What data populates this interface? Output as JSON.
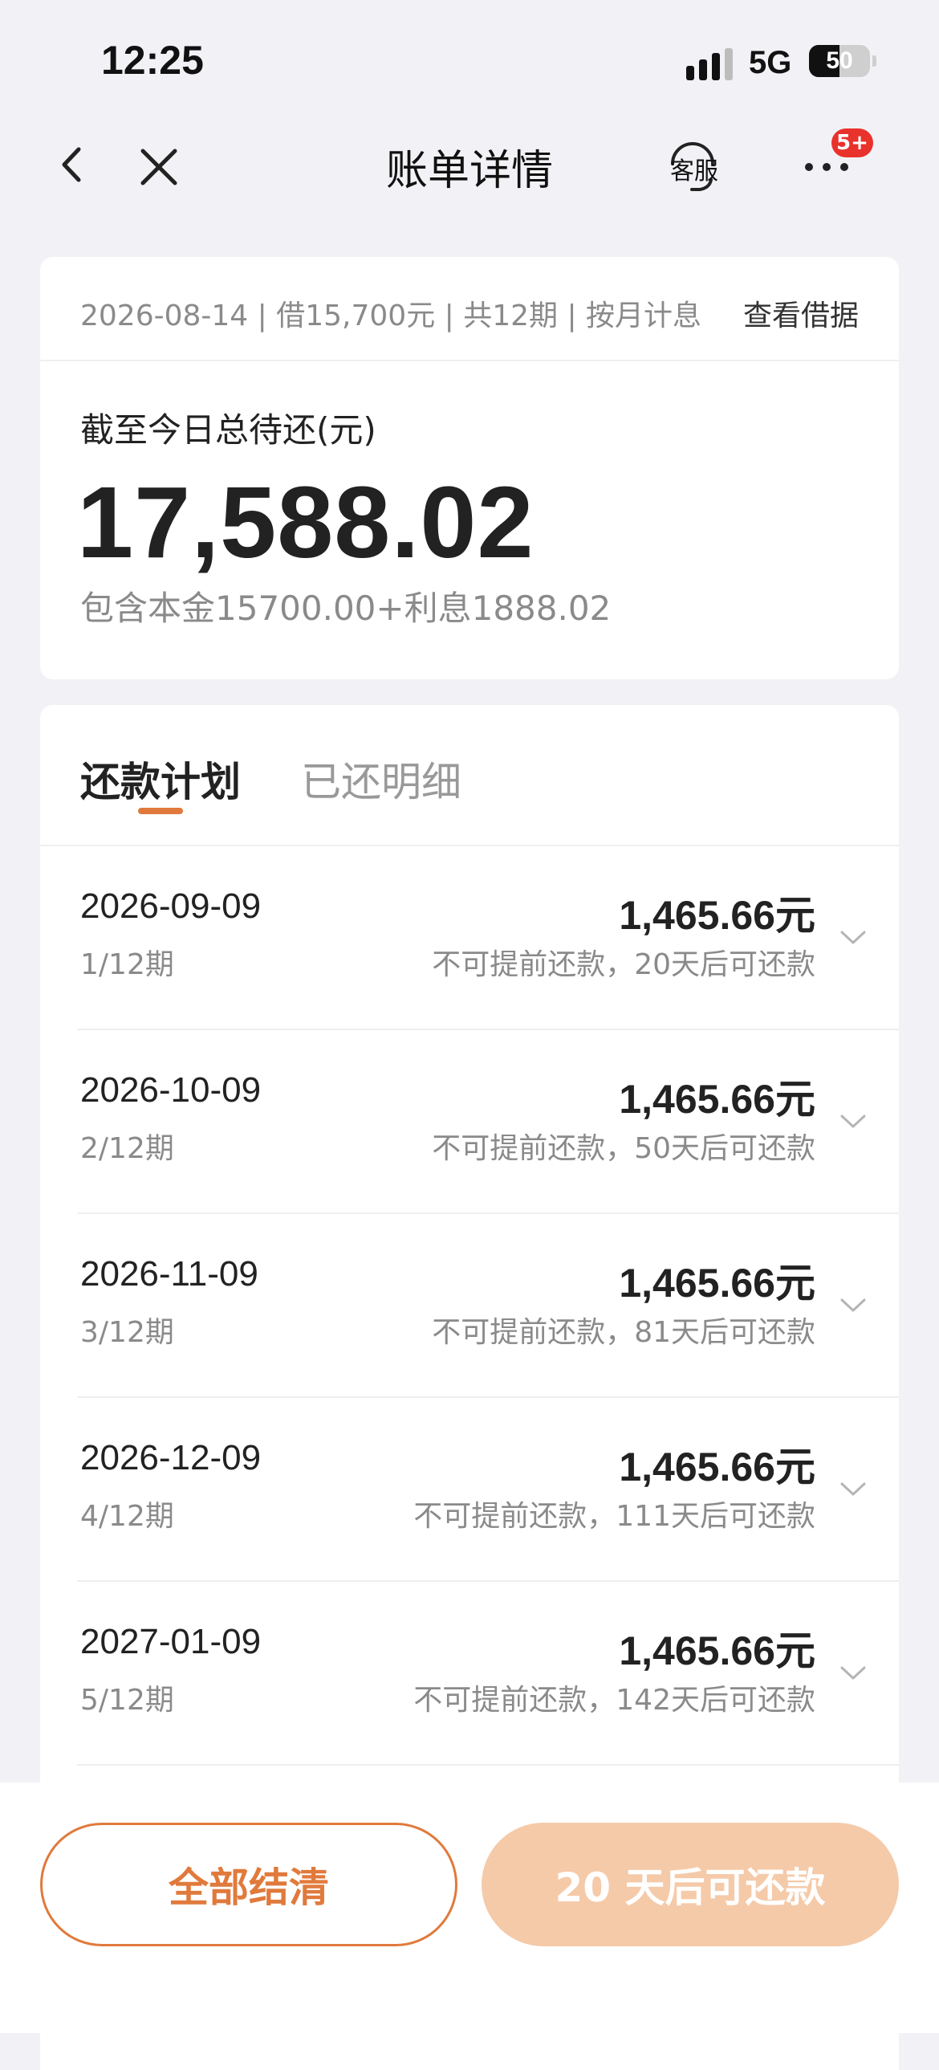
{
  "status_bar": {
    "time": "12:25",
    "network": "5G",
    "battery": "50",
    "battery_level_percent": 50
  },
  "nav": {
    "title": "账单详情",
    "customer_service_label": "客服",
    "more_badge": "5+",
    "back_icon": "chevron-left-icon",
    "close_icon": "close-icon",
    "more_icon": "ellipsis-icon"
  },
  "summary": {
    "meta": "2026-08-14 | 借15,700元 | 共12期 | 按月计息",
    "view_loan_link": "查看借据",
    "total_label": "截至今日总待还(元)",
    "total_amount": "17,588.02",
    "breakdown": "包含本金15700.00+利息1888.02"
  },
  "plan": {
    "tabs": [
      {
        "label": "还款计划",
        "active": true
      },
      {
        "label": "已还明细",
        "active": false
      }
    ],
    "accent_color": "#e07a3c",
    "rows": [
      {
        "date": "2026-09-09",
        "period": "1/12期",
        "amount": "1,465.66元",
        "note": "不可提前还款，20天后可还款"
      },
      {
        "date": "2026-10-09",
        "period": "2/12期",
        "amount": "1,465.66元",
        "note": "不可提前还款，50天后可还款"
      },
      {
        "date": "2026-11-09",
        "period": "3/12期",
        "amount": "1,465.66元",
        "note": "不可提前还款，81天后可还款"
      },
      {
        "date": "2026-12-09",
        "period": "4/12期",
        "amount": "1,465.66元",
        "note": "不可提前还款，111天后可还款"
      },
      {
        "date": "2027-01-09",
        "period": "5/12期",
        "amount": "1,465.66元",
        "note": "不可提前还款，142天后可还款"
      }
    ]
  },
  "actions": {
    "settle_all_label": "全部结清",
    "pay_label": "20 天后可还款",
    "settle_color": "#e07a3c",
    "pay_bg_color": "#f5caa9"
  }
}
